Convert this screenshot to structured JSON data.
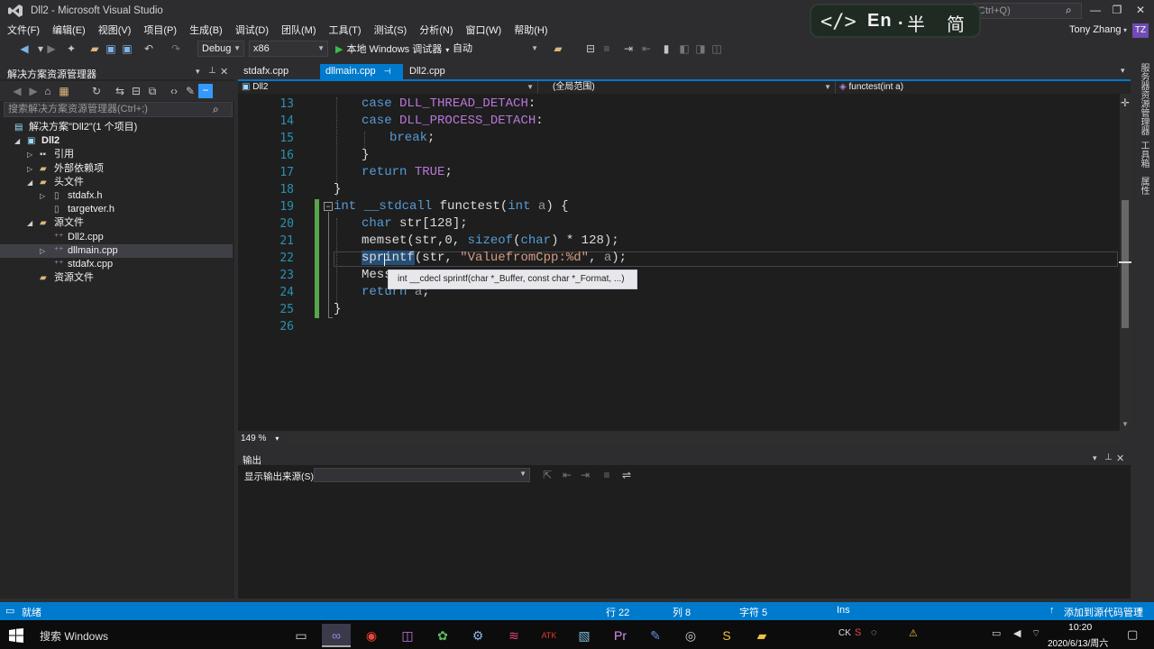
{
  "title_bar": {
    "window_title": "Dll2 - Microsoft Visual Studio",
    "quick_launch_placeholder": "Ctrl+Q)",
    "ime": {
      "code": "</>",
      "lang": "En",
      "dot": ".",
      "mode_half": "半",
      "mode_simplified": "简"
    }
  },
  "menu": {
    "items": [
      "文件(F)",
      "编辑(E)",
      "视图(V)",
      "项目(P)",
      "生成(B)",
      "调试(D)",
      "团队(M)",
      "工具(T)",
      "测试(S)",
      "分析(N)",
      "窗口(W)",
      "帮助(H)"
    ],
    "user_name": "Tony Zhang",
    "user_initials": "TZ"
  },
  "toolbar": {
    "config": "Debug",
    "platform": "x86",
    "start_debug": "本地 Windows 调试器",
    "solution_config": "自动"
  },
  "solution_explorer": {
    "title": "解决方案资源管理器",
    "search_placeholder": "搜索解决方案资源管理器(Ctrl+;)",
    "tree": [
      {
        "label": "解决方案\"Dll2\"(1 个项目)",
        "icon": "solution-icon"
      },
      {
        "label": "Dll2",
        "icon": "project-icon"
      },
      {
        "label": "引用",
        "icon": "references-icon"
      },
      {
        "label": "外部依赖项",
        "icon": "external-deps-icon"
      },
      {
        "label": "头文件",
        "icon": "folder-icon"
      },
      {
        "label": "stdafx.h",
        "icon": "header-file-icon"
      },
      {
        "label": "targetver.h",
        "icon": "header-file-icon"
      },
      {
        "label": "源文件",
        "icon": "folder-icon"
      },
      {
        "label": "Dll2.cpp",
        "icon": "cpp-file-icon"
      },
      {
        "label": "dllmain.cpp",
        "icon": "cpp-file-icon"
      },
      {
        "label": "stdafx.cpp",
        "icon": "cpp-file-icon"
      },
      {
        "label": "资源文件",
        "icon": "folder-icon"
      }
    ]
  },
  "editor": {
    "tabs": [
      "stdafx.cpp",
      "dllmain.cpp",
      "Dll2.cpp"
    ],
    "active_tab": "dllmain.cpp",
    "nav": {
      "project": "Dll2",
      "scope": "(全局范围)",
      "member": "functest(int a)"
    },
    "line_numbers": [
      "13",
      "14",
      "15",
      "16",
      "17",
      "18",
      "19",
      "20",
      "21",
      "22",
      "23",
      "24",
      "25",
      "26"
    ],
    "code": {
      "l13_kw": "case",
      "l13_mac": "DLL_THREAD_DETACH",
      "l13_rest": ":",
      "l14_kw": "case",
      "l14_mac": "DLL_PROCESS_DETACH",
      "l14_rest": ":",
      "l15_kw": "break",
      "l15_rest": ";",
      "l16": "}",
      "l17_kw": "return",
      "l17_mac": "TRUE",
      "l17_rest": ";",
      "l18": "}",
      "l19_kw": "int",
      "l19_kw2": "__stdcall",
      "l19_fn": "functest",
      "l19_open": "(",
      "l19_kw3": "int",
      "l19_param": "a",
      "l19_rest": ") {",
      "l20_kw": "char",
      "l20_rest": "str[128];",
      "l21_fn": "memset",
      "l21_a": "(str,0, ",
      "l21_kw": "sizeof",
      "l21_b": "(",
      "l21_kw2": "char",
      "l21_c": ") * 128);",
      "l22_fn": "sprintf",
      "l22_a": "(str, ",
      "l22_str": "\"ValuefromCpp:%d\"",
      "l22_b": ", ",
      "l22_param": "a",
      "l22_c": ");",
      "l23": "Mess",
      "l24_kw": "return",
      "l24_param": "a",
      "l24_rest": ";",
      "l25": "}"
    },
    "tooltip": "int __cdecl sprintf(char *_Buffer, const char *_Format, ...)",
    "zoom": "149 %"
  },
  "output": {
    "title": "输出",
    "source_label": "显示输出来源(S):"
  },
  "side_tabs": [
    "服务器资源管理器",
    "工具箱",
    "属性"
  ],
  "status": {
    "ready": "就绪",
    "line": "行 22",
    "col": "列 8",
    "char": "字符 5",
    "ins": "Ins",
    "source_control": "添加到源代码管理"
  },
  "taskbar": {
    "search": "搜索 Windows",
    "time": "10:20",
    "date": "2020/6/13/周六"
  }
}
